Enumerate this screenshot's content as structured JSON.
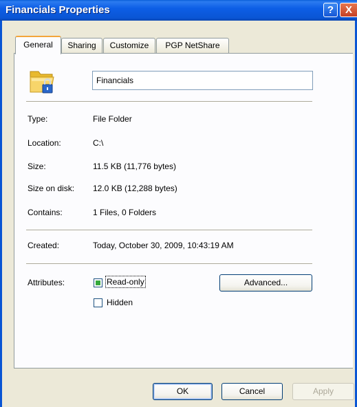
{
  "window": {
    "title": "Financials Properties",
    "help_glyph": "?",
    "close_glyph": "X"
  },
  "tabs": [
    {
      "label": "General",
      "active": true
    },
    {
      "label": "Sharing",
      "active": false
    },
    {
      "label": "Customize",
      "active": false
    },
    {
      "label": "PGP NetShare",
      "active": false
    }
  ],
  "general": {
    "icon": "locked-folder-icon",
    "name_value": "Financials",
    "type_label": "Type:",
    "type_value": "File Folder",
    "location_label": "Location:",
    "location_value": "C:\\",
    "size_label": "Size:",
    "size_value": "11.5 KB (11,776 bytes)",
    "size_on_disk_label": "Size on disk:",
    "size_on_disk_value": "12.0 KB (12,288 bytes)",
    "contains_label": "Contains:",
    "contains_value": "1 Files, 0 Folders",
    "created_label": "Created:",
    "created_value": "Today, October 30, 2009, 10:43:19 AM",
    "attributes_label": "Attributes:",
    "readonly_label": "Read-only",
    "readonly_state": "indeterminate",
    "hidden_label": "Hidden",
    "hidden_state": "unchecked",
    "advanced_label": "Advanced..."
  },
  "buttons": {
    "ok": "OK",
    "cancel": "Cancel",
    "apply": "Apply"
  },
  "colors": {
    "titlebar": "#0a55d4",
    "tab_highlight": "#f3a53a",
    "checkbox_fill": "#34a83c"
  }
}
